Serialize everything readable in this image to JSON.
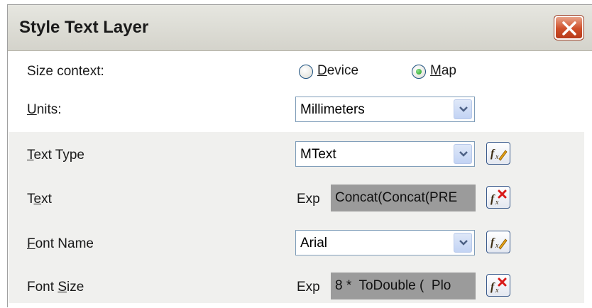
{
  "dialog": {
    "title": "Style Text Layer",
    "close_icon": "close-x-icon"
  },
  "size_context": {
    "label": "Size context:",
    "options": [
      {
        "label": "Device",
        "mnemonic": "D",
        "rest": "evice",
        "selected": false
      },
      {
        "label": "Map",
        "mnemonic": "M",
        "rest": "ap",
        "selected": true
      }
    ]
  },
  "units": {
    "label_mnemonic": "U",
    "label_rest": "nits:",
    "value": "Millimeters"
  },
  "text_type": {
    "label_mnemonic": "T",
    "label_rest": "ext Type",
    "value": "MText",
    "button_icon": "expression-edit-icon"
  },
  "text": {
    "label_pre": "T",
    "label_mnemonic": "e",
    "label_post": "xt",
    "exp_label": "Exp",
    "expression": "Concat(Concat(PRE",
    "button_icon": "expression-clear-icon"
  },
  "font_name": {
    "label_mnemonic": "F",
    "label_rest": "ont Name",
    "value": "Arial",
    "button_icon": "expression-edit-icon"
  },
  "font_size": {
    "label_pre": "Font ",
    "label_mnemonic": "S",
    "label_post": "ize",
    "exp_label": "Exp",
    "expression": "8 *  ToDouble (  Plo",
    "button_icon": "expression-clear-icon"
  },
  "colors": {
    "dialog_bg": "#ece9d8",
    "band_bg": "#f0f0ee",
    "exp_box_bg": "#9b9b9b",
    "close_red": "#cf4f2a",
    "radio_green": "#1f9e1f"
  }
}
